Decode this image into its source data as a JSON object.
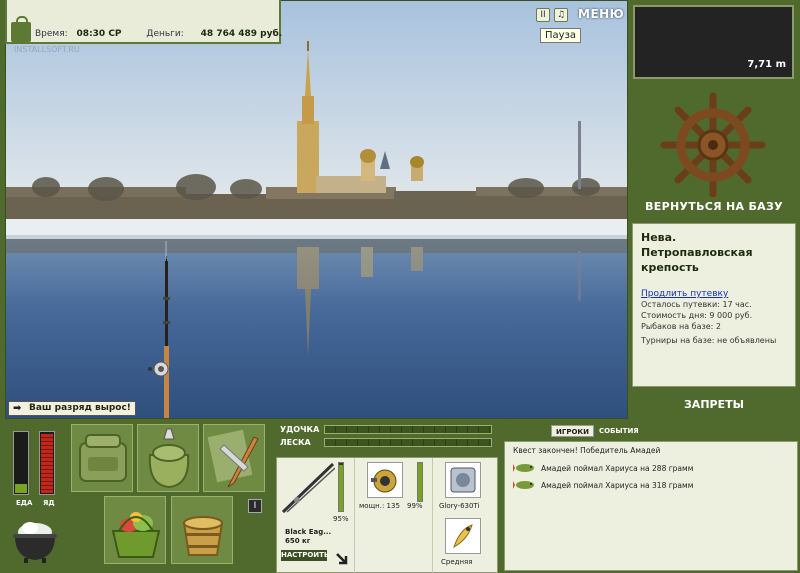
{
  "status": {
    "time_label": "Время:",
    "time_value": "08:30 СР",
    "money_label": "Деньги:",
    "money_value": "48 764 489 руб."
  },
  "top_controls": {
    "pause_glyph": "II",
    "sound_glyph": "♫",
    "menu_label": "МЕНЮ",
    "pause_tooltip": "Пауза"
  },
  "watermark": "INSTALLSOFT.RU",
  "rank_message": "Ваш разряд вырос!",
  "depth": "7,71 m",
  "sidebar": {
    "return_label": "ВЕРНУТЬСЯ НА БАЗУ",
    "location_title": "Нева. Петропавловская крепость",
    "extend_link": "Продлить путевку",
    "info_lines": [
      "Осталось путевки: 17 час.",
      "Стоимость дня: 9 000 руб.",
      "Рыбаков на базе: 2",
      "Турниры на базе: не объявлены"
    ],
    "bans_label": "ЗАПРЕТЫ"
  },
  "meters": {
    "food_label": "ЕДА",
    "poison_label": "ЯД",
    "food_level": 0.15,
    "poison_level": 0.95
  },
  "tackle": {
    "rod_label": "УДОЧКА",
    "line_label": "ЛЕСКА",
    "rod_name": "Black Eag...",
    "rod_weight": "650 кг",
    "rod_condition": "95%",
    "reel_stats": "мощн.: 135",
    "reel_condition": "99%",
    "line_name": "Glory-630Ti",
    "bait_label": "Средняя",
    "adjust_button": "НАСТРОИТЬ",
    "rod_level": 0.95,
    "reel_level": 0.99
  },
  "log": {
    "tab_players": "ИГРОКИ",
    "tab_events": "СОБЫТИЯ",
    "entries": [
      "Квест закончен! Победитель Амадей",
      "Амадей поймал Хариуса на 288 грамм",
      "Амадей поймал Хариуса на 318 грамм"
    ]
  },
  "colors": {
    "panel_green": "#4f6a2c",
    "panel_light": "#eef0df",
    "sky_top": "#a9c3de",
    "water": "#3c5f8c",
    "poison_red": "#c0281c",
    "level_green": "#7aa31f"
  }
}
